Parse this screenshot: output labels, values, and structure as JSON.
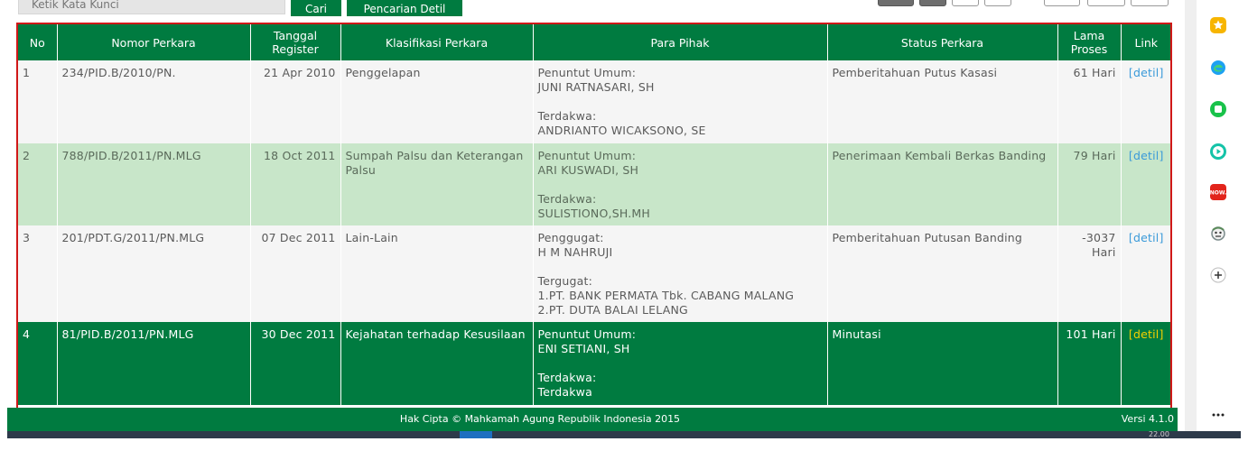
{
  "search": {
    "placeholder": "Ketik Kata Kunci"
  },
  "buttons": {
    "search_label": "Cari",
    "advanced_label": "Pencarian Detil"
  },
  "table": {
    "headers": {
      "no": "No",
      "nomor": "Nomor Perkara",
      "tanggal": "Tanggal Register",
      "klasifikasi": "Klasifikasi Perkara",
      "pihak": "Para Pihak",
      "status": "Status Perkara",
      "lama": "Lama Proses",
      "link": "Link"
    },
    "rows": [
      {
        "no": "1",
        "nomor": "234/PID.B/2010/PN.",
        "tanggal": "21 Apr 2010",
        "klasifikasi": "Penggelapan",
        "pihak1_label": "Penuntut Umum:",
        "pihak1_name": "JUNI RATNASARI, SH",
        "pihak2_label": "Terdakwa:",
        "pihak2_name": "ANDRIANTO WICAKSONO, SE",
        "status": "Pemberitahuan Putus Kasasi",
        "lama": "61 Hari",
        "link": "[detil]"
      },
      {
        "no": "2",
        "nomor": "788/PID.B/2011/PN.MLG",
        "tanggal": "18 Oct 2011",
        "klasifikasi": "Sumpah Palsu dan Keterangan Palsu",
        "pihak1_label": "Penuntut Umum:",
        "pihak1_name": "ARI KUSWADI, SH",
        "pihak2_label": "Terdakwa:",
        "pihak2_name": "SULISTIONO,SH.MH",
        "status": "Penerimaan Kembali Berkas Banding",
        "lama": "79 Hari",
        "link": "[detil]"
      },
      {
        "no": "3",
        "nomor": "201/PDT.G/2011/PN.MLG",
        "tanggal": "07 Dec 2011",
        "klasifikasi": "Lain-Lain",
        "pihak1_label": "Penggugat:",
        "pihak1_name": "H M NAHRUJI",
        "pihak2_label": "Tergugat:",
        "pihak2_name": "1.PT. BANK PERMATA Tbk. CABANG MALANG",
        "pihak2_name_b": "2.PT. DUTA BALAI LELANG",
        "status": "Pemberitahuan Putusan Banding",
        "lama": "-3037 Hari",
        "link": "[detil]"
      },
      {
        "no": "4",
        "nomor": "81/PID.B/2011/PN.MLG",
        "tanggal": "30 Dec 2011",
        "klasifikasi": "Kejahatan terhadap Kesusilaan",
        "pihak1_label": "Penuntut Umum:",
        "pihak1_name": "ENI SETIANI, SH",
        "pihak2_label": "Terdakwa:",
        "pihak2_name": "Terdakwa",
        "status": "Minutasi",
        "lama": "101 Hari",
        "link": "[detil]"
      }
    ]
  },
  "footer": {
    "copyright": "Hak Cipta © Mahkamah Agung Republik Indonesia 2015",
    "version": "Versi 4.1.0"
  },
  "taskbar": {
    "time": "22.00"
  },
  "colors": {
    "brand_green": "#007b40",
    "alt_row_green": "#c8e6c9",
    "highlight_border": "#d01818",
    "link_blue": "#3a9ad9",
    "link_yellow": "#f4d000"
  },
  "sidebar_icons": [
    "favorites-star-icon",
    "edge-icon",
    "green-square-icon",
    "media-play-icon",
    "now-app-icon",
    "avatar-icon",
    "add-icon",
    "more-icon"
  ]
}
